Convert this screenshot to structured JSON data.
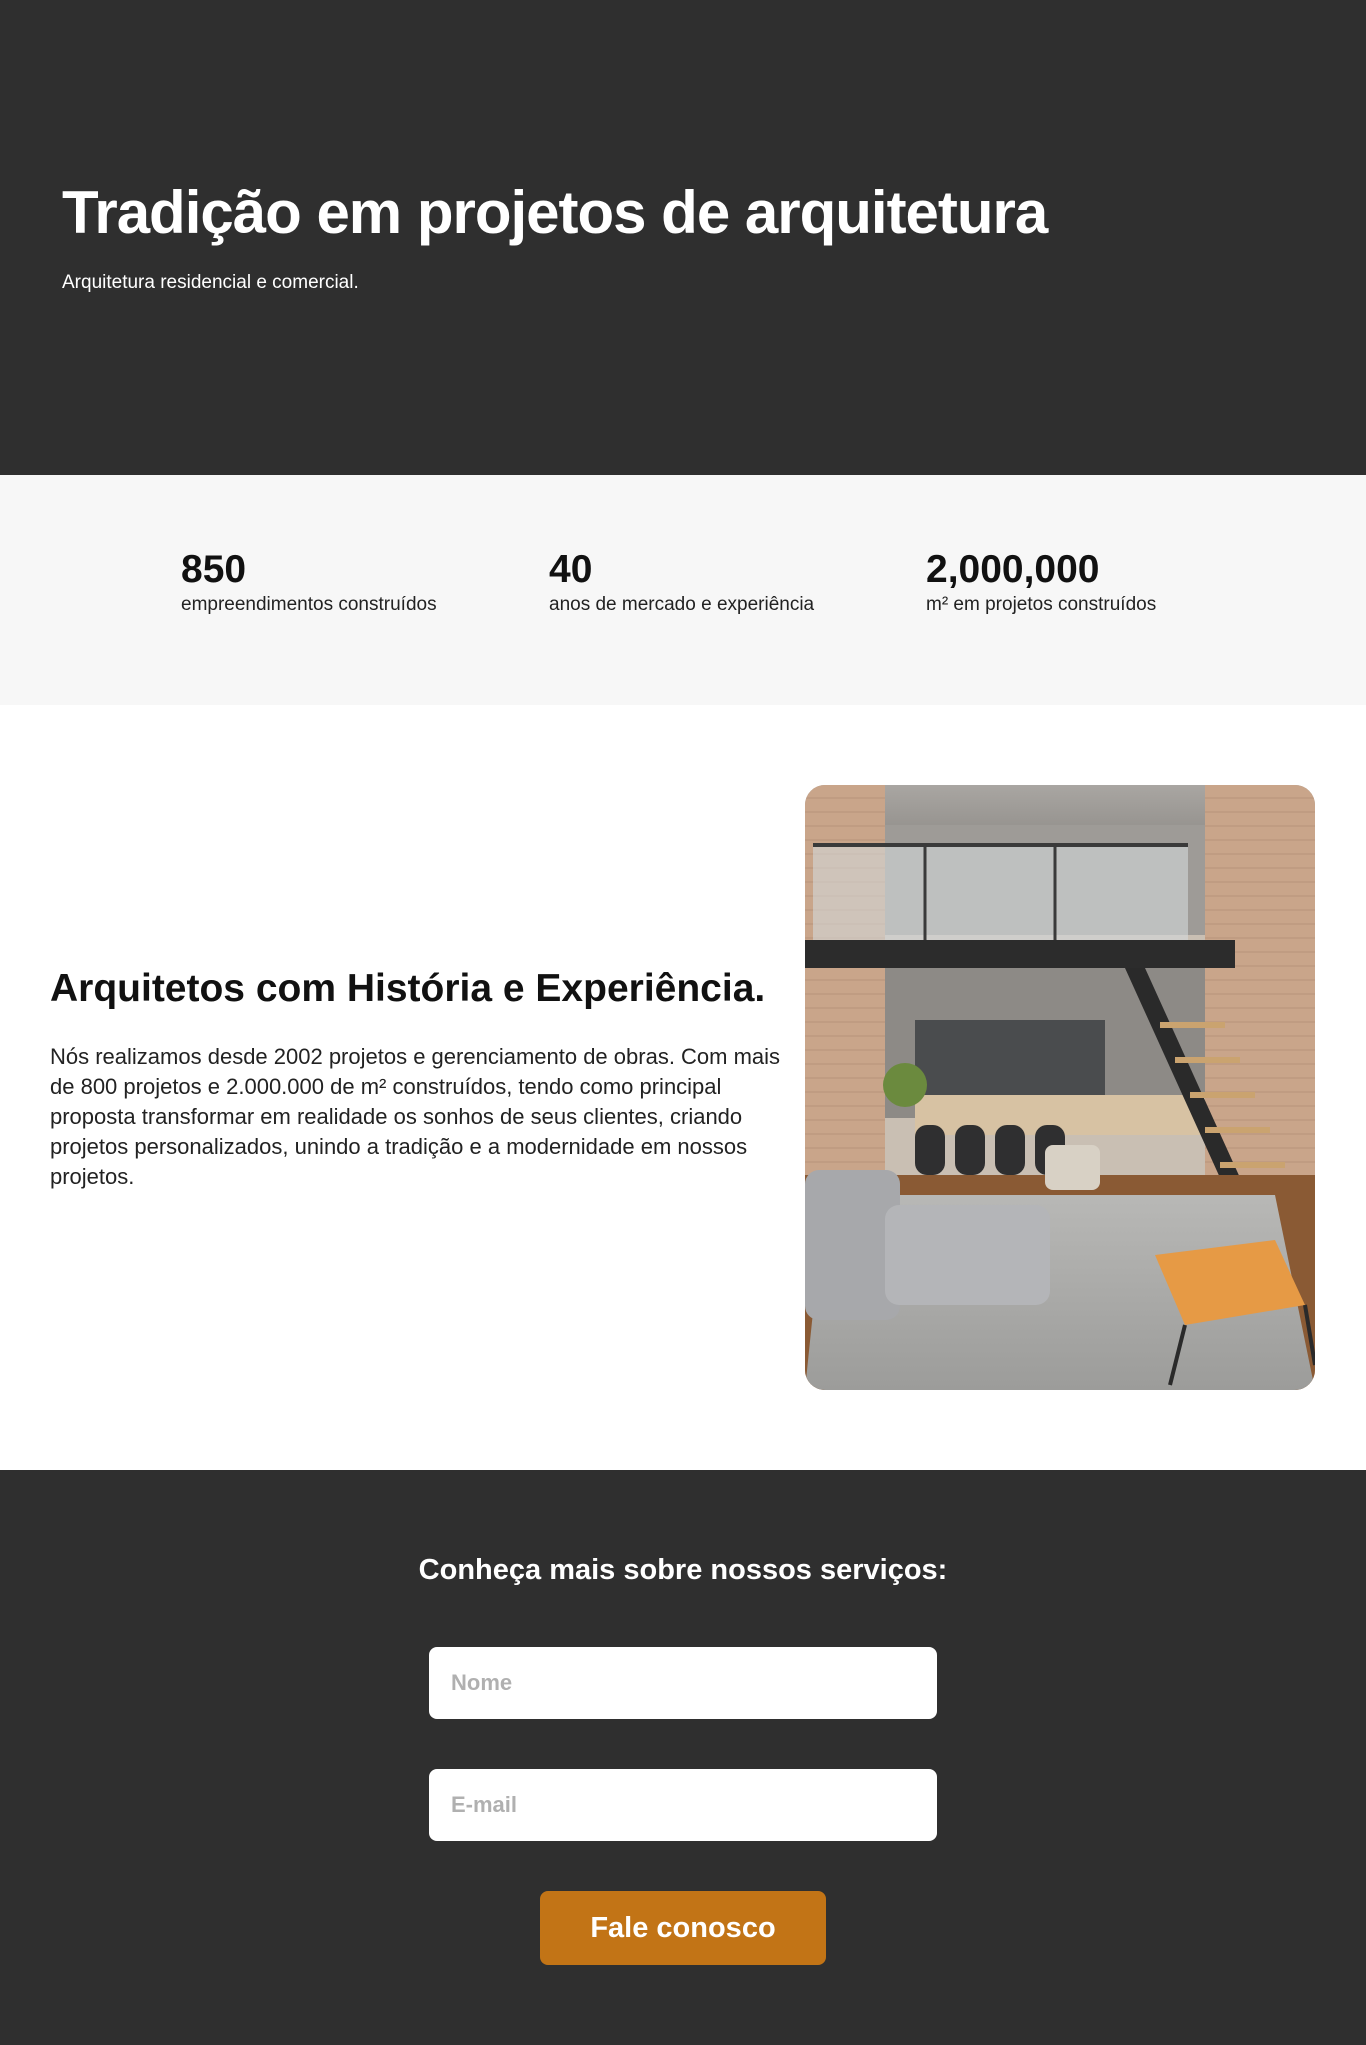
{
  "hero": {
    "title": "Tradição em projetos de arquitetura",
    "subtitle": "Arquitetura residencial e comercial."
  },
  "stats": [
    {
      "value": "850",
      "label": "empreendimentos construídos"
    },
    {
      "value": "40",
      "label": "anos de mercado e experiência"
    },
    {
      "value": "2,000,000",
      "label": "m² em projetos construídos"
    }
  ],
  "about": {
    "title": "Arquitetos com História e Experiência.",
    "text": "Nós realizamos desde 2002 projetos e gerenciamento de obras. Com mais de 800 projetos e 2.000.000 de m² construídos, tendo como principal proposta transformar em realidade os sonhos de seus clientes, criando projetos personalizados, unindo a tradição e a modernidade em nossos projetos."
  },
  "contact": {
    "title": "Conheça mais sobre nossos serviços:",
    "name_placeholder": "Nome",
    "email_placeholder": "E-mail",
    "button_label": "Fale conosco",
    "button_color": "#c27416"
  },
  "colors": {
    "dark_bg": "#2f2f2f",
    "stats_bg": "#f7f7f7"
  }
}
